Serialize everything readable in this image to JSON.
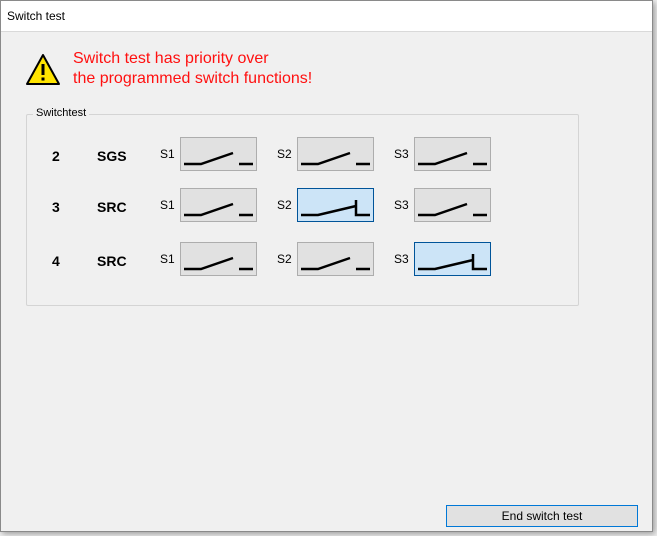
{
  "window": {
    "title": "Switch test"
  },
  "warning": {
    "line1": "Switch test has priority over",
    "line2": "the programmed switch functions!"
  },
  "group": {
    "label": "Switchtest"
  },
  "rows": [
    {
      "num": "2",
      "type": "SGS",
      "switches": [
        {
          "label": "S1",
          "state": "open"
        },
        {
          "label": "S2",
          "state": "open"
        },
        {
          "label": "S3",
          "state": "open"
        }
      ]
    },
    {
      "num": "3",
      "type": "SRC",
      "switches": [
        {
          "label": "S1",
          "state": "open"
        },
        {
          "label": "S2",
          "state": "closed"
        },
        {
          "label": "S3",
          "state": "open"
        }
      ]
    },
    {
      "num": "4",
      "type": "SRC",
      "switches": [
        {
          "label": "S1",
          "state": "open"
        },
        {
          "label": "S2",
          "state": "open"
        },
        {
          "label": "S3",
          "state": "closed"
        }
      ]
    }
  ],
  "buttons": {
    "end_switch_test": "End switch test"
  },
  "colors": {
    "warning_text": "#ff1010",
    "active_bg": "#cce4f7",
    "active_border": "#005499"
  }
}
